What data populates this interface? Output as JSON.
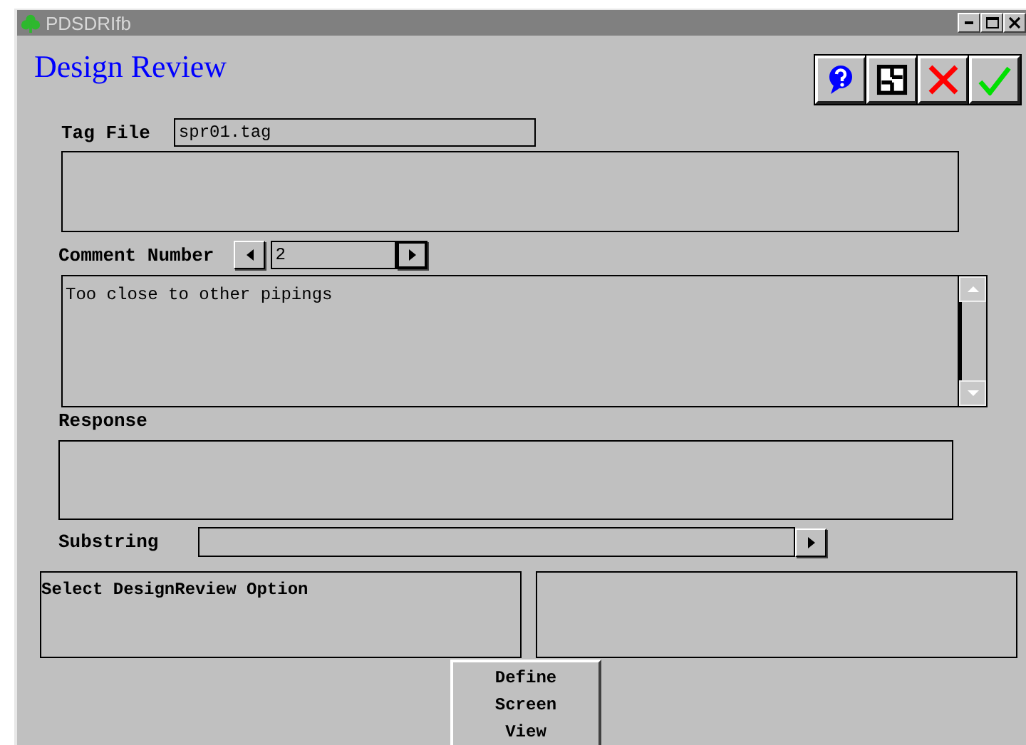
{
  "window": {
    "title": "PDSDRIfb"
  },
  "form_title": "Design Review",
  "tag_file": {
    "label": "Tag File",
    "value": "spr01.tag"
  },
  "comment_number": {
    "label": "Comment Number",
    "value": "2"
  },
  "comment": {
    "value": "Too close to other pipings"
  },
  "response": {
    "label": "Response"
  },
  "substring": {
    "label": "Substring"
  },
  "message": {
    "text": "Select DesignReview Option"
  },
  "define_button": {
    "label": "Define Screen View"
  }
}
